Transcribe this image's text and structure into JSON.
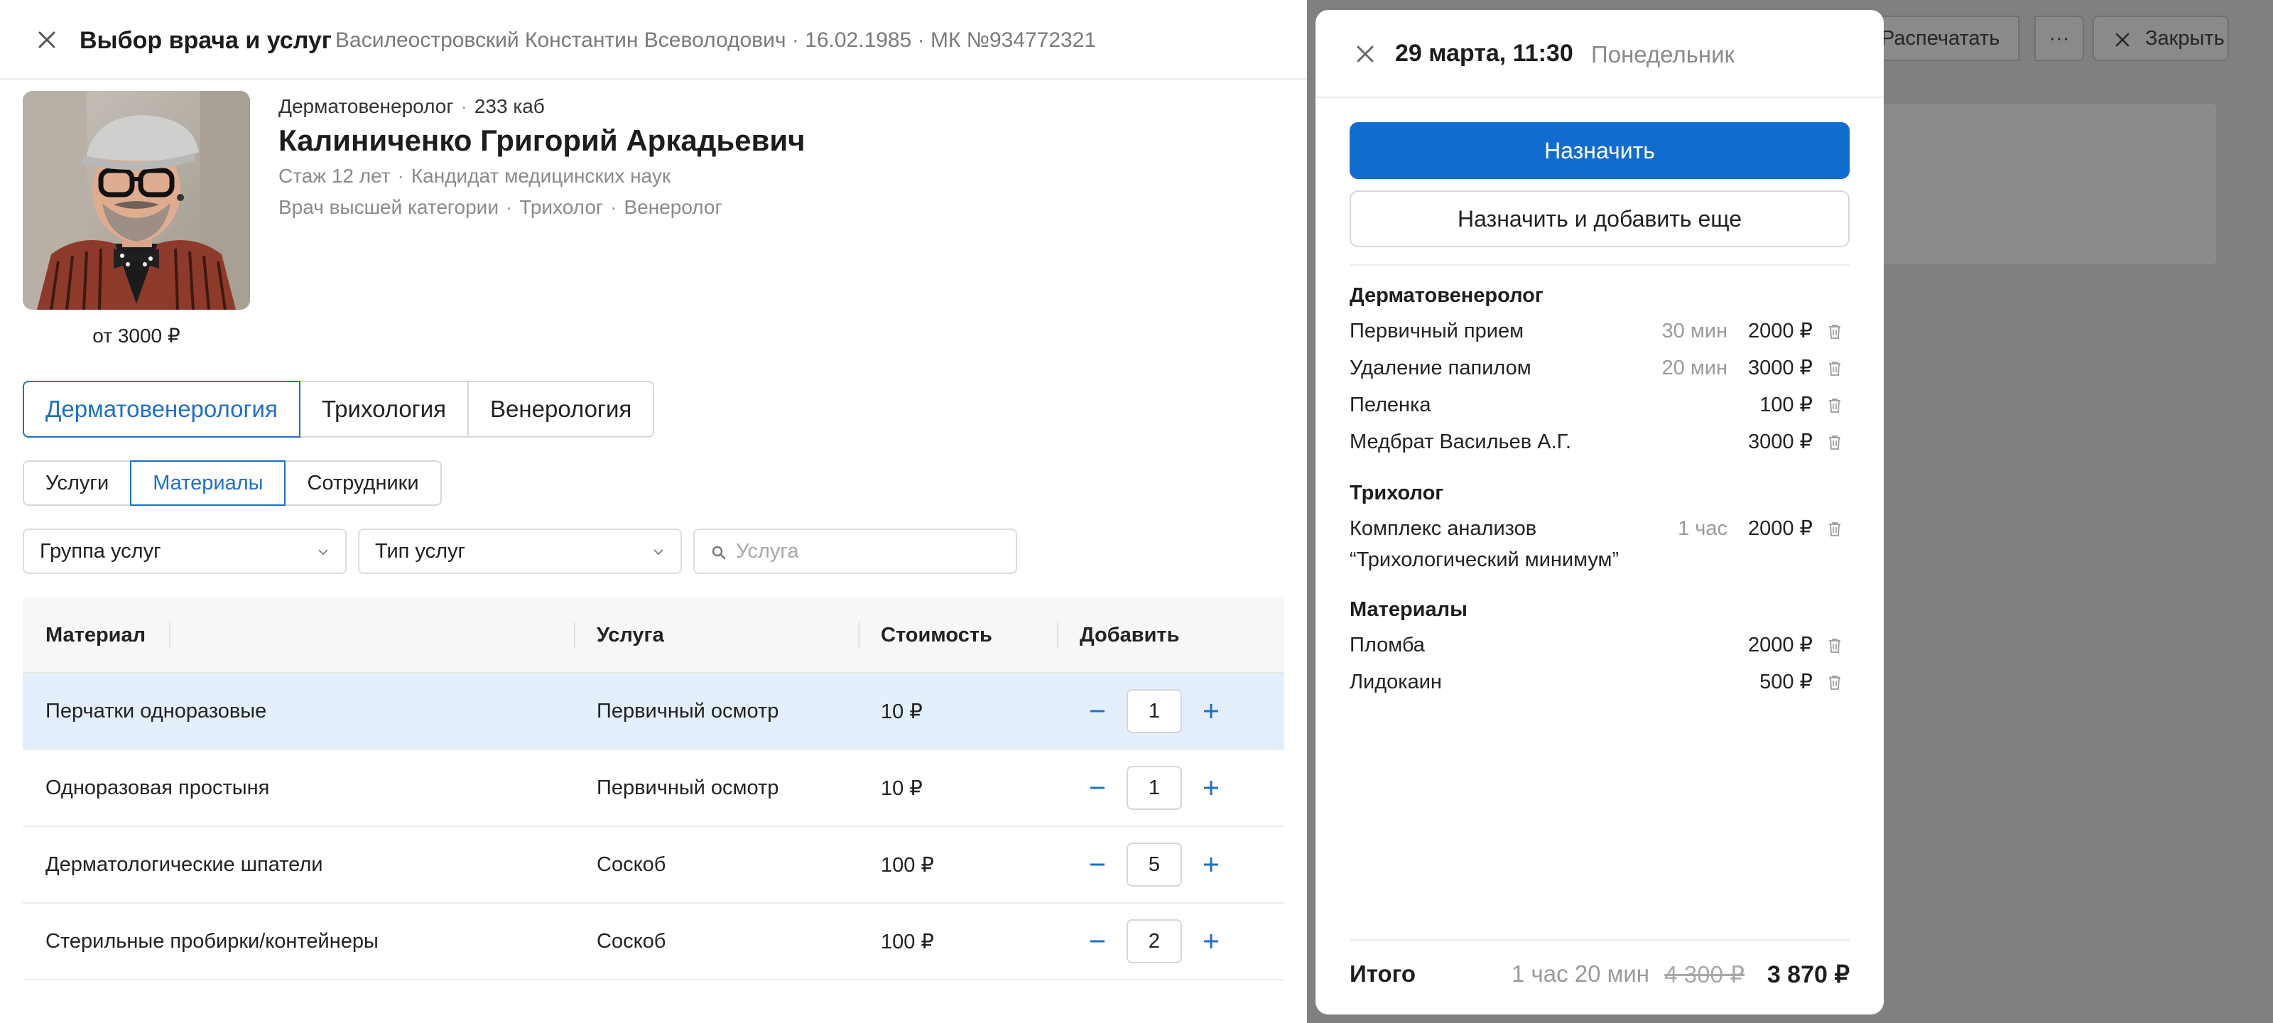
{
  "header": {
    "title": "Выбор врача и услуг",
    "patient": "Василеостровский Константин Всеволодович · 16.02.1985 · МК №934772321"
  },
  "doctor": {
    "specialty": "Дерматовенеролог",
    "room": "233 каб",
    "name": "Калиниченко Григорий Аркадьевич",
    "experience": "Стаж 12 лет",
    "degree": "Кандидат медицинских наук",
    "category": "Врач высшей категории",
    "tag1": "Трихолог",
    "tag2": "Венеролог",
    "price_from": "от 3000 ₽"
  },
  "specialty_tabs": [
    "Дерматовенерология",
    "Трихология",
    "Венерология"
  ],
  "section_tabs": [
    "Услуги",
    "Материалы",
    "Сотрудники"
  ],
  "filters": {
    "group": "Группа услуг",
    "type": "Тип услуг",
    "search_placeholder": "Услуга"
  },
  "table": {
    "columns": [
      "Материал",
      "Услуга",
      "Стоимость",
      "Добавить"
    ],
    "rows": [
      {
        "material": "Перчатки одноразовые",
        "service": "Первичный осмотр",
        "price": "10 ₽",
        "qty": "1"
      },
      {
        "material": "Одноразовая простыня",
        "service": "Первичный осмотр",
        "price": "10 ₽",
        "qty": "1"
      },
      {
        "material": "Дерматологические шпатели",
        "service": "Соскоб",
        "price": "100 ₽",
        "qty": "5"
      },
      {
        "material": "Стерильные пробирки/контейнеры",
        "service": "Соскоб",
        "price": "100 ₽",
        "qty": "2"
      }
    ]
  },
  "background_toolbar": {
    "print_label": "Распечатать",
    "more_label": "···",
    "close_label": "Закрыть"
  },
  "appointment": {
    "date": "29 марта, 11:30",
    "weekday": "Понедельник",
    "assign_label": "Назначить",
    "assign_more_label": "Назначить и добавить еще",
    "groups": [
      {
        "title": "Дерматовенеролог",
        "items": [
          {
            "name": "Первичный прием",
            "duration": "30 мин",
            "price": "2000 ₽"
          },
          {
            "name": "Удаление папилом",
            "duration": "20 мин",
            "price": "3000 ₽"
          },
          {
            "name": "Пеленка",
            "duration": "",
            "price": "100 ₽"
          },
          {
            "name": "Медбрат Васильев А.Г.",
            "duration": "",
            "price": "3000 ₽"
          }
        ]
      },
      {
        "title": "Трихолог",
        "items": [
          {
            "name": "Комплекс анализов",
            "name2": "“Трихологический минимум”",
            "duration": "1 час",
            "price": "2000 ₽"
          }
        ]
      },
      {
        "title": "Материалы",
        "items": [
          {
            "name": "Пломба",
            "duration": "",
            "price": "2000 ₽"
          },
          {
            "name": "Лидокаин",
            "duration": "",
            "price": "500 ₽"
          }
        ]
      }
    ],
    "total_label": "Итого",
    "total_time": "1 час 20 мин",
    "total_old": "4 300 ₽",
    "total_new": "3 870 ₽"
  },
  "colors": {
    "accent": "#1e6fc7",
    "primary_button": "#116cd0",
    "row_highlight": "#e3effb",
    "overlay": "#808080"
  }
}
